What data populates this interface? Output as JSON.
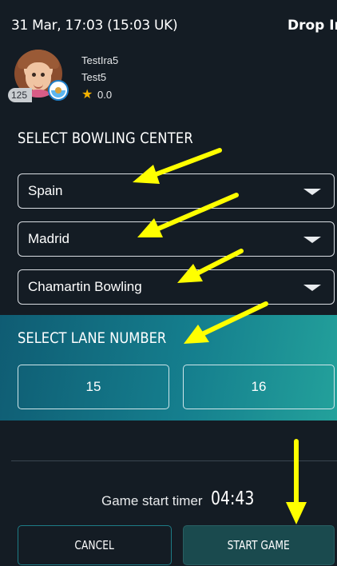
{
  "header": {
    "datetime": "31 Mar, 17:03 (15:03 UK)",
    "mode": "Drop In"
  },
  "profile": {
    "name": "TestIra5",
    "handle": "Test5",
    "rating": "0.0",
    "level": "125"
  },
  "center": {
    "title": "SELECT BOWLING CENTER",
    "country": "Spain",
    "city": "Madrid",
    "venue": "Chamartin Bowling"
  },
  "lanes": {
    "title": "SELECT LANE NUMBER",
    "options": [
      "15",
      "16"
    ]
  },
  "timer": {
    "label": "Game start timer",
    "value": "04:43"
  },
  "actions": {
    "cancel": "CANCEL",
    "start": "START GAME"
  },
  "annotation_color": "#ffff00",
  "icons": {
    "caret": "chevron-down-icon",
    "star": "star-icon",
    "flag": "flag-icon"
  }
}
